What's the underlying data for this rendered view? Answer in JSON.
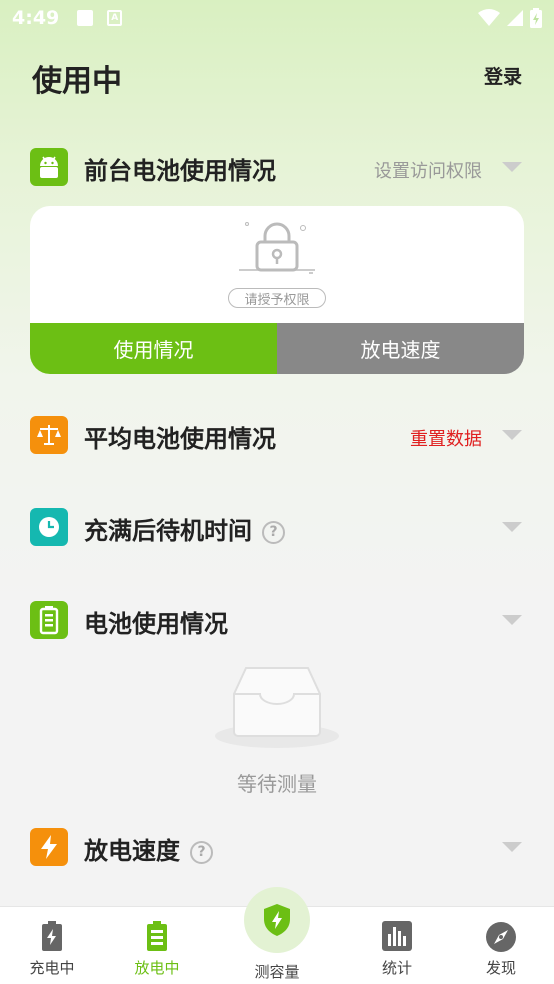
{
  "status_bar": {
    "time": "4:49",
    "a_icon_label": "A"
  },
  "header": {
    "title": "使用中",
    "login_label": "登录"
  },
  "sections": {
    "foreground": {
      "title": "前台电池使用情况",
      "action": "设置访问权限"
    },
    "average": {
      "title": "平均电池使用情况",
      "action": "重置数据"
    },
    "standby": {
      "title": "充满后待机时间",
      "help": "?"
    },
    "battery_usage": {
      "title": "电池使用情况"
    },
    "discharge_speed": {
      "title": "放电速度",
      "help": "?"
    }
  },
  "permission_card": {
    "badge": "请授予权限",
    "tabs": [
      {
        "label": "使用情况",
        "active": true
      },
      {
        "label": "放电速度",
        "active": false
      }
    ]
  },
  "empty_state": {
    "text": "等待测量"
  },
  "bottom_nav": {
    "items": [
      {
        "label": "充电中",
        "icon": "battery-charging-icon",
        "active": false
      },
      {
        "label": "放电中",
        "icon": "battery-discharging-icon",
        "active": true
      },
      {
        "label": "测容量",
        "icon": "shield-bolt-icon",
        "active": false
      },
      {
        "label": "统计",
        "icon": "bar-chart-icon",
        "active": false
      },
      {
        "label": "发现",
        "icon": "compass-icon",
        "active": false
      }
    ]
  },
  "colors": {
    "accent_green": "#6cbf14",
    "android_green": "#6cbf14",
    "orange": "#f5900c",
    "teal": "#15b8b0",
    "warning_red": "#e02020",
    "tab_grey": "#888888"
  }
}
